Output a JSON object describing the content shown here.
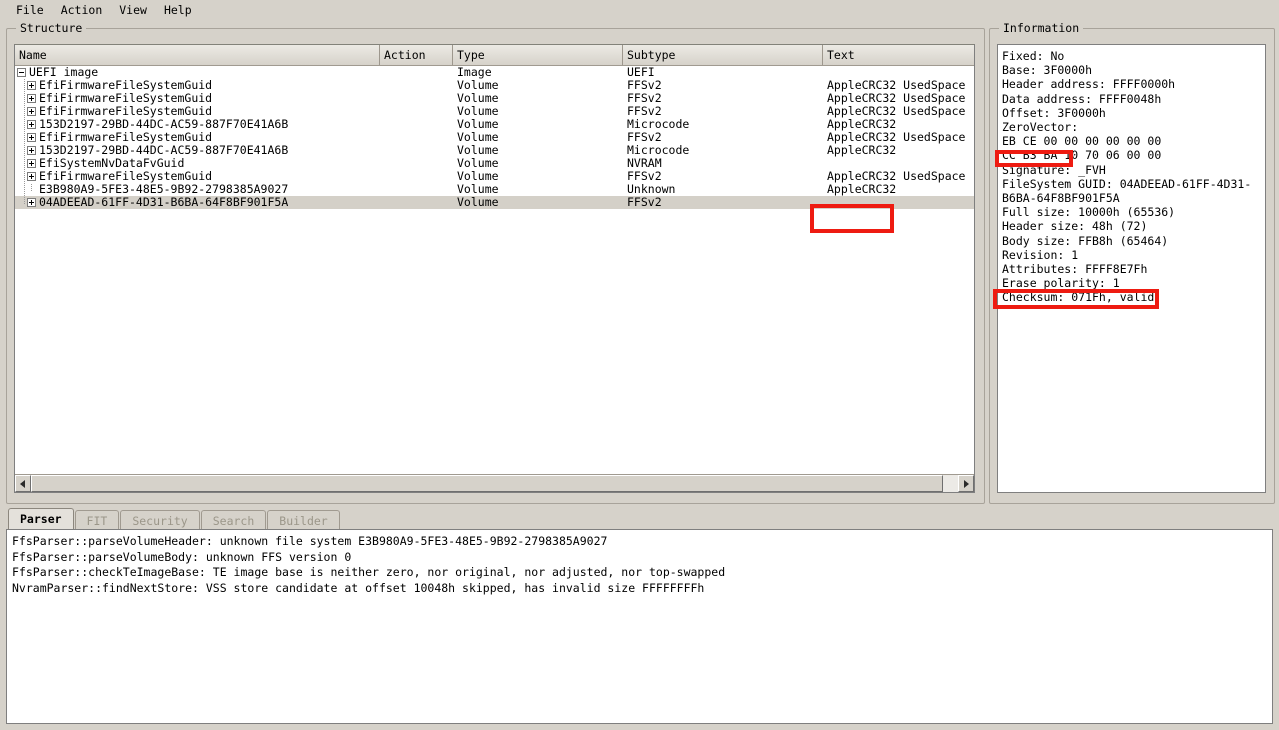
{
  "menu": {
    "items": [
      {
        "label": "File"
      },
      {
        "label": "Action"
      },
      {
        "label": "View"
      },
      {
        "label": "Help"
      }
    ]
  },
  "structure": {
    "title": "Structure",
    "columns": [
      "Name",
      "Action",
      "Type",
      "Subtype",
      "Text"
    ],
    "rows": [
      {
        "name": "UEFI image",
        "depth": 0,
        "expander": "minus",
        "action": "",
        "type": "Image",
        "subtype": "UEFI",
        "text": "",
        "selected": false
      },
      {
        "name": "EfiFirmwareFileSystemGuid",
        "depth": 1,
        "expander": "plus",
        "action": "",
        "type": "Volume",
        "subtype": "FFSv2",
        "text": "AppleCRC32 UsedSpace",
        "selected": false
      },
      {
        "name": "EfiFirmwareFileSystemGuid",
        "depth": 1,
        "expander": "plus",
        "action": "",
        "type": "Volume",
        "subtype": "FFSv2",
        "text": "AppleCRC32 UsedSpace",
        "selected": false
      },
      {
        "name": "EfiFirmwareFileSystemGuid",
        "depth": 1,
        "expander": "plus",
        "action": "",
        "type": "Volume",
        "subtype": "FFSv2",
        "text": "AppleCRC32 UsedSpace",
        "selected": false
      },
      {
        "name": "153D2197-29BD-44DC-AC59-887F70E41A6B",
        "depth": 1,
        "expander": "plus",
        "action": "",
        "type": "Volume",
        "subtype": "Microcode",
        "text": "AppleCRC32",
        "selected": false
      },
      {
        "name": "EfiFirmwareFileSystemGuid",
        "depth": 1,
        "expander": "plus",
        "action": "",
        "type": "Volume",
        "subtype": "FFSv2",
        "text": "AppleCRC32 UsedSpace",
        "selected": false
      },
      {
        "name": "153D2197-29BD-44DC-AC59-887F70E41A6B",
        "depth": 1,
        "expander": "plus",
        "action": "",
        "type": "Volume",
        "subtype": "Microcode",
        "text": "AppleCRC32",
        "selected": false
      },
      {
        "name": "EfiSystemNvDataFvGuid",
        "depth": 1,
        "expander": "plus",
        "action": "",
        "type": "Volume",
        "subtype": "NVRAM",
        "text": "",
        "selected": false
      },
      {
        "name": "EfiFirmwareFileSystemGuid",
        "depth": 1,
        "expander": "plus",
        "action": "",
        "type": "Volume",
        "subtype": "FFSv2",
        "text": "AppleCRC32 UsedSpace",
        "selected": false
      },
      {
        "name": "E3B980A9-5FE3-48E5-9B92-2798385A9027",
        "depth": 1,
        "expander": "none",
        "action": "",
        "type": "Volume",
        "subtype": "Unknown",
        "text": "AppleCRC32",
        "selected": false
      },
      {
        "name": "04ADEEAD-61FF-4D31-B6BA-64F8BF901F5A",
        "depth": 1,
        "expander": "plus",
        "action": "",
        "type": "Volume",
        "subtype": "FFSv2",
        "text": "",
        "selected": true
      }
    ]
  },
  "information": {
    "title": "Information",
    "lines": [
      "Fixed: No",
      "Base: 3F0000h",
      "Header address: FFFF0000h",
      "Data address: FFFF0048h",
      "Offset: 3F0000h",
      "ZeroVector:",
      "EB CE 00 00 00 00 00 00",
      "CC B3 BA 10 70 06 00 00",
      "Signature: _FVH",
      "FileSystem GUID: 04ADEEAD-61FF-4D31-",
      "B6BA-64F8BF901F5A",
      "Full size: 10000h (65536)",
      "Header size: 48h (72)",
      "Body size: FFB8h (65464)",
      "Revision: 1",
      "Attributes: FFFF8E7Fh",
      "Erase polarity: 1",
      "Checksum: 071Fh, valid"
    ]
  },
  "bottom": {
    "tabs": [
      {
        "label": "Parser",
        "active": true
      },
      {
        "label": "FIT",
        "active": false
      },
      {
        "label": "Security",
        "active": false
      },
      {
        "label": "Search",
        "active": false
      },
      {
        "label": "Builder",
        "active": false
      }
    ],
    "log_lines": [
      "FfsParser::parseVolumeHeader: unknown file system E3B980A9-5FE3-48E5-9B92-2798385A9027",
      "FfsParser::parseVolumeBody: unknown FFS version 0",
      "FfsParser::checkTeImageBase: TE image base is neither zero, nor original, nor adjusted, nor top-swapped",
      "NvramParser::findNextStore: VSS store candidate at offset 10048h skipped, has invalid size FFFFFFFFh"
    ]
  },
  "annotations": {
    "color": "#ee1b11",
    "boxes": [
      {
        "name": "text-column-empty-cell"
      },
      {
        "name": "zerovector-bytes"
      },
      {
        "name": "checksum-line"
      }
    ]
  }
}
